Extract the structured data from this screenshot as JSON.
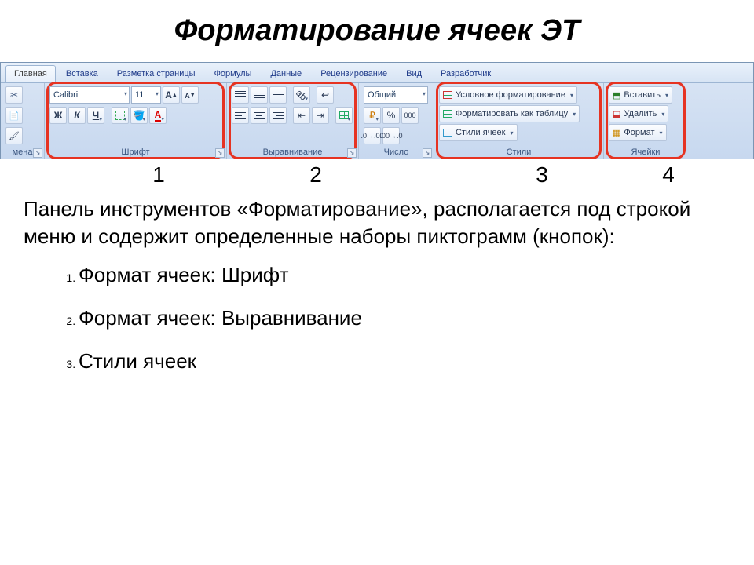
{
  "title": "Форматирование ячеек ЭТ",
  "ribbon": {
    "tabs": [
      "Главная",
      "Вставка",
      "Разметка страницы",
      "Формулы",
      "Данные",
      "Рецензирование",
      "Вид",
      "Разработчик"
    ],
    "active_tab": 0,
    "clipboard": {
      "label": "мена"
    },
    "font": {
      "label": "Шрифт",
      "name": "Calibri",
      "size": "11",
      "bold": "Ж",
      "italic": "К",
      "underline": "Ч",
      "font_color_letter": "А"
    },
    "alignment": {
      "label": "Выравнивание"
    },
    "number": {
      "label": "Число",
      "format": "Общий",
      "percent": "%",
      "thousands": "000"
    },
    "styles": {
      "label": "Стили",
      "cond": "Условное форматирование",
      "astable": "Форматировать как таблицу",
      "cellstyles": "Стили ячеек"
    },
    "cells": {
      "label": "Ячейки",
      "insert": "Вставить",
      "delete": "Удалить",
      "format": "Формат"
    }
  },
  "numbers": [
    "1",
    "2",
    "3",
    "4"
  ],
  "paragraph": "Панель инструментов «Форматирование», располагается под строкой меню и содержит определенные наборы пиктограмм (кнопок):",
  "list": [
    "Формат ячеек: Шрифт",
    "Формат ячеек: Выравнивание",
    "Стили ячеек"
  ]
}
